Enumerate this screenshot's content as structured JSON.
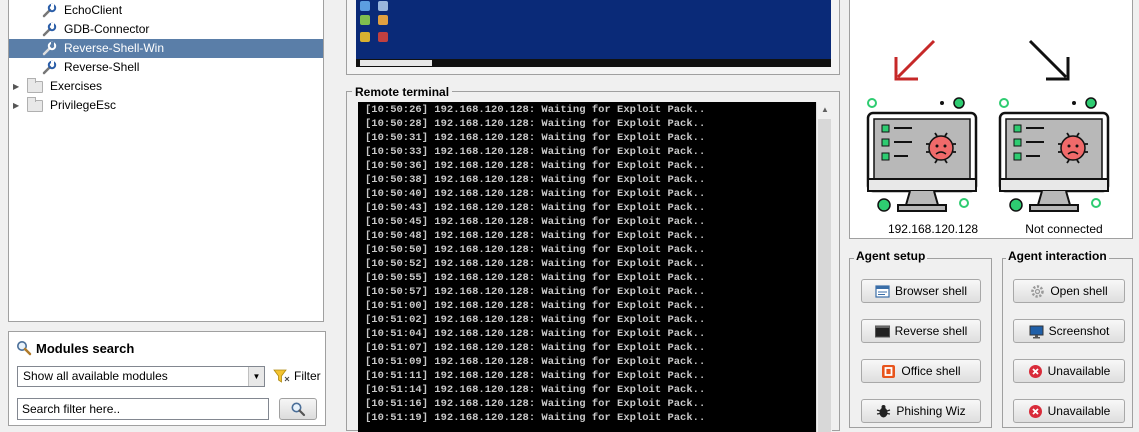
{
  "module_tree": {
    "items": [
      {
        "label": "EchoClient",
        "type": "module",
        "selected": false
      },
      {
        "label": "GDB-Connector",
        "type": "module",
        "selected": false
      },
      {
        "label": "Reverse-Shell-Win",
        "type": "module",
        "selected": true
      },
      {
        "label": "Reverse-Shell",
        "type": "module",
        "selected": false
      },
      {
        "label": "Exercises",
        "type": "folder",
        "selected": false
      },
      {
        "label": "PrivilegeEsc",
        "type": "folder",
        "selected": false
      }
    ]
  },
  "modules_search": {
    "title": "Modules search",
    "dropdown_value": "Show all available modules",
    "filter_label": "Filter",
    "search_placeholder": "Search filter here.."
  },
  "terminal": {
    "title": "Remote terminal",
    "lines": [
      "[10:50:26] 192.168.120.128: Waiting for Exploit Pack..",
      "[10:50:28] 192.168.120.128: Waiting for Exploit Pack..",
      "[10:50:31] 192.168.120.128: Waiting for Exploit Pack..",
      "[10:50:33] 192.168.120.128: Waiting for Exploit Pack..",
      "[10:50:36] 192.168.120.128: Waiting for Exploit Pack..",
      "[10:50:38] 192.168.120.128: Waiting for Exploit Pack..",
      "[10:50:40] 192.168.120.128: Waiting for Exploit Pack..",
      "[10:50:43] 192.168.120.128: Waiting for Exploit Pack..",
      "[10:50:45] 192.168.120.128: Waiting for Exploit Pack..",
      "[10:50:48] 192.168.120.128: Waiting for Exploit Pack..",
      "[10:50:50] 192.168.120.128: Waiting for Exploit Pack..",
      "[10:50:52] 192.168.120.128: Waiting for Exploit Pack..",
      "[10:50:55] 192.168.120.128: Waiting for Exploit Pack..",
      "[10:50:57] 192.168.120.128: Waiting for Exploit Pack..",
      "[10:51:00] 192.168.120.128: Waiting for Exploit Pack..",
      "[10:51:02] 192.168.120.128: Waiting for Exploit Pack..",
      "[10:51:04] 192.168.120.128: Waiting for Exploit Pack..",
      "[10:51:07] 192.168.120.128: Waiting for Exploit Pack..",
      "[10:51:09] 192.168.120.128: Waiting for Exploit Pack..",
      "[10:51:11] 192.168.120.128: Waiting for Exploit Pack..",
      "[10:51:14] 192.168.120.128: Waiting for Exploit Pack..",
      "[10:51:16] 192.168.120.128: Waiting for Exploit Pack..",
      "[10:51:19] 192.168.120.128: Waiting for Exploit Pack.."
    ]
  },
  "agents": {
    "left": {
      "caption": "192.168.120.128",
      "arrow_color": "#c62828"
    },
    "right": {
      "caption": "Not connected",
      "arrow_color": "#111111"
    }
  },
  "agent_setup": {
    "title": "Agent setup",
    "buttons": [
      {
        "label": "Browser shell",
        "icon": "browser-icon"
      },
      {
        "label": "Reverse shell",
        "icon": "terminal-icon"
      },
      {
        "label": "Office shell",
        "icon": "office-icon"
      },
      {
        "label": "Phishing Wiz",
        "icon": "bug-icon"
      }
    ]
  },
  "agent_interaction": {
    "title": "Agent interaction",
    "buttons": [
      {
        "label": "Open shell",
        "icon": "gear-icon"
      },
      {
        "label": "Screenshot",
        "icon": "monitor-icon"
      },
      {
        "label": "Unavailable",
        "icon": "error-icon"
      },
      {
        "label": "Unavailable",
        "icon": "error-icon"
      }
    ]
  },
  "colors": {
    "selection": "#5a7ea8",
    "terminal_bg": "#000000",
    "terminal_fg": "#c8c8c8",
    "accent_green": "#2ecc71",
    "bug_red": "#f06a6a"
  }
}
